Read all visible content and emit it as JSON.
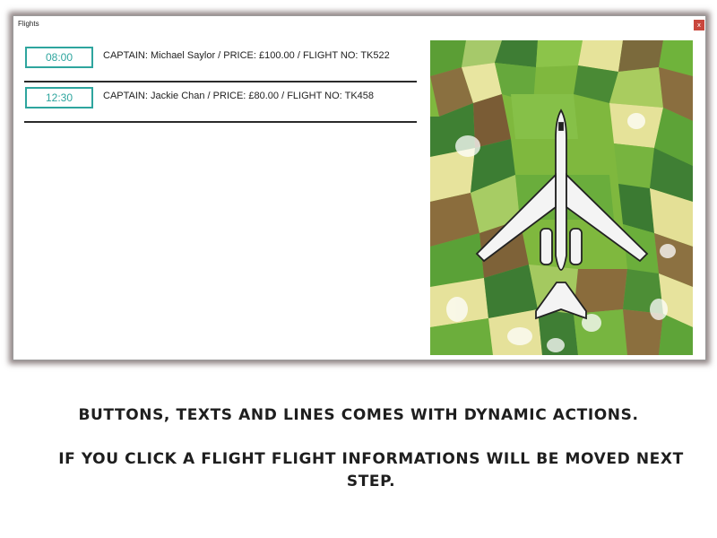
{
  "window": {
    "title": "Flights",
    "close_label": "x"
  },
  "flights": [
    {
      "time": "08:00",
      "info": "CAPTAIN: Michael Saylor / PRICE: £100.00 / FLIGHT NO: TK522"
    },
    {
      "time": "12:30",
      "info": "CAPTAIN: Jackie Chan / PRICE: £80.00 / FLIGHT NO: TK458"
    }
  ],
  "photo": {
    "subject": "airplane-over-farmland-aerial-view"
  },
  "captions": {
    "line1": "BUTTONS, TEXTS AND LINES COMES WITH DYNAMIC ACTIONS.",
    "line2": "IF YOU CLICK A FLIGHT FLIGHT INFORMATIONS WILL BE MOVED NEXT STEP."
  },
  "colors": {
    "accent": "#2ea59e",
    "close": "#c9473d",
    "divider": "#2a2a2a"
  }
}
